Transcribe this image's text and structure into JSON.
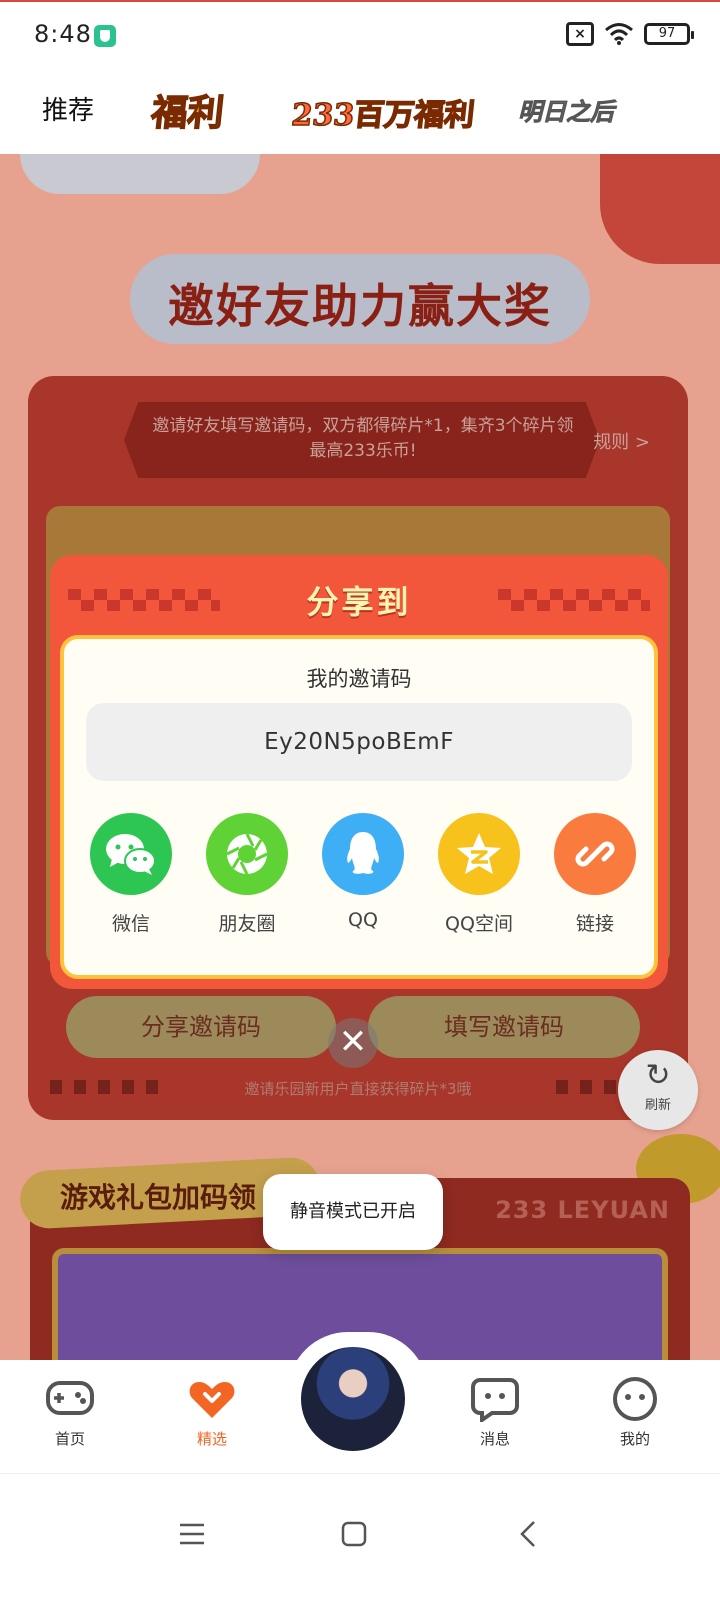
{
  "status_bar": {
    "time": "8:48",
    "battery": "97"
  },
  "top_tabs": {
    "recommend": "推荐",
    "fuli": "福利",
    "million_fuli": "233百万福利",
    "mingri": "明日之后"
  },
  "page": {
    "banner_title": "邀好友助力赢大奖",
    "invite_desc": "邀请好友填写邀请码，双方都得碎片*1，集齐3个碎片领最高233乐币!",
    "rules_link": "规则 >",
    "share_code_button": "分享邀请码",
    "fill_code_button": "填写邀请码",
    "new_user_tip": "邀请乐园新用户直接获得碎片*3哦",
    "gift_section_title": "游戏礼包加码领",
    "leyuan_text": "233 LEYUAN"
  },
  "share_modal": {
    "title": "分享到",
    "code_label": "我的邀请码",
    "invite_code": "Ey20N5poBEmF",
    "options": [
      {
        "label": "微信",
        "icon": "wechat-icon",
        "color": "#2dc653"
      },
      {
        "label": "朋友圈",
        "icon": "moments-icon",
        "color": "#5fd235"
      },
      {
        "label": "QQ",
        "icon": "qq-icon",
        "color": "#3eaef5"
      },
      {
        "label": "QQ空间",
        "icon": "qzone-icon",
        "color": "#f7c21c"
      },
      {
        "label": "链接",
        "icon": "link-icon",
        "color": "#f97c3e"
      }
    ]
  },
  "refresh": {
    "label": "刷新"
  },
  "toast": {
    "text": "静音模式已开启"
  },
  "bottom_nav": {
    "items": [
      {
        "label": "首页",
        "icon": "gamepad-icon"
      },
      {
        "label": "精选",
        "icon": "heart-chevron-icon",
        "active": true
      },
      {
        "label": "消息",
        "icon": "chat-bubble-icon"
      },
      {
        "label": "我的",
        "icon": "face-icon"
      }
    ]
  },
  "colors": {
    "accent": "#f26522",
    "modal_red": "#f2573b",
    "gold_border": "#ffc23b"
  }
}
